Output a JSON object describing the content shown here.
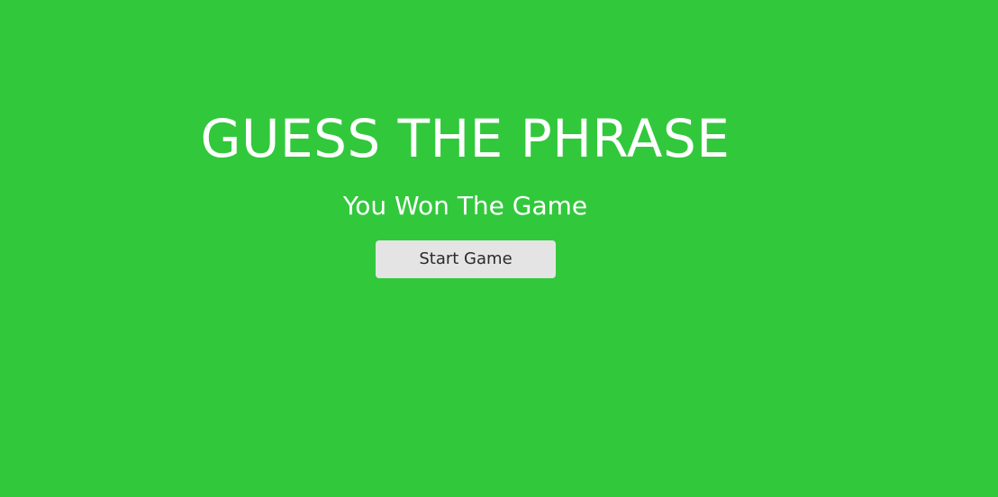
{
  "overlay": {
    "title": "GUESS THE PHRASE",
    "message": "You Won The Game",
    "start_button_label": "Start Game"
  },
  "colors": {
    "background": "#32c83c",
    "text": "#ffffff",
    "button_background": "#e4e4e4",
    "button_text": "#2a2a2a"
  }
}
